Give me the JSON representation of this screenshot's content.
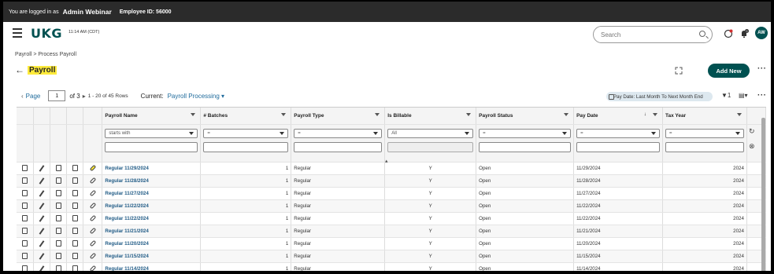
{
  "topbar": {
    "logged_in_text": "You are logged in as",
    "user_name": "Admin Webinar",
    "employee_id": "Employee ID: 56000"
  },
  "header": {
    "logo": "UKG",
    "time": "11:14 AM (CDT)",
    "search_placeholder": "Search",
    "avatar_initials": "AW",
    "notification_count": "0"
  },
  "breadcrumb": "Payroll > Process Payroll",
  "page": {
    "title": "Payroll",
    "add_new_label": "Add New",
    "back_arrow": "←",
    "more": "···"
  },
  "pager": {
    "page_label": "Page",
    "page_value": "1",
    "of_label": "of 3",
    "rows_label": "1 - 20 of 45 Rows",
    "current_label": "Current:",
    "current_view": "Payroll Processing",
    "filter_chip": "Pay Date: Last Month To Next Month End",
    "filter_count": "1"
  },
  "columns": [
    "Payroll Name",
    "# Batches",
    "Payroll Type",
    "Is Billable",
    "Payroll Status",
    "Pay Date",
    "Tax Year"
  ],
  "filters": {
    "payroll_name": "starts with",
    "batches": "=",
    "payroll_type": "=",
    "is_billable": "All",
    "payroll_status": "=",
    "pay_date": "=",
    "tax_year": "="
  },
  "rows": [
    {
      "name": "Regular 11/29/2024",
      "batches": "1",
      "type": "Regular",
      "billable": "Y",
      "status": "Open",
      "pay_date": "11/29/2024",
      "tax_year": "2024"
    },
    {
      "name": "Regular 11/28/2024",
      "batches": "1",
      "type": "Regular",
      "billable": "Y",
      "status": "Open",
      "pay_date": "11/28/2024",
      "tax_year": "2024"
    },
    {
      "name": "Regular 11/27/2024",
      "batches": "1",
      "type": "Regular",
      "billable": "Y",
      "status": "Open",
      "pay_date": "11/27/2024",
      "tax_year": "2024"
    },
    {
      "name": "Regular 11/22/2024",
      "batches": "1",
      "type": "Regular",
      "billable": "Y",
      "status": "Open",
      "pay_date": "11/22/2024",
      "tax_year": "2024"
    },
    {
      "name": "Regular 11/22/2024",
      "batches": "1",
      "type": "Regular",
      "billable": "Y",
      "status": "Open",
      "pay_date": "11/22/2024",
      "tax_year": "2024"
    },
    {
      "name": "Regular 11/21/2024",
      "batches": "1",
      "type": "Regular",
      "billable": "Y",
      "status": "Open",
      "pay_date": "11/21/2024",
      "tax_year": "2024"
    },
    {
      "name": "Regular 11/20/2024",
      "batches": "1",
      "type": "Regular",
      "billable": "Y",
      "status": "Open",
      "pay_date": "11/20/2024",
      "tax_year": "2024"
    },
    {
      "name": "Regular 11/15/2024",
      "batches": "1",
      "type": "Regular",
      "billable": "Y",
      "status": "Open",
      "pay_date": "11/15/2024",
      "tax_year": "2024"
    },
    {
      "name": "Regular 11/14/2024",
      "batches": "1",
      "type": "Regular",
      "billable": "Y",
      "status": "Open",
      "pay_date": "11/14/2024",
      "tax_year": "2024"
    }
  ],
  "colors": {
    "brand": "#005151",
    "link": "#1f5a85",
    "highlight": "#ffeb3b"
  }
}
